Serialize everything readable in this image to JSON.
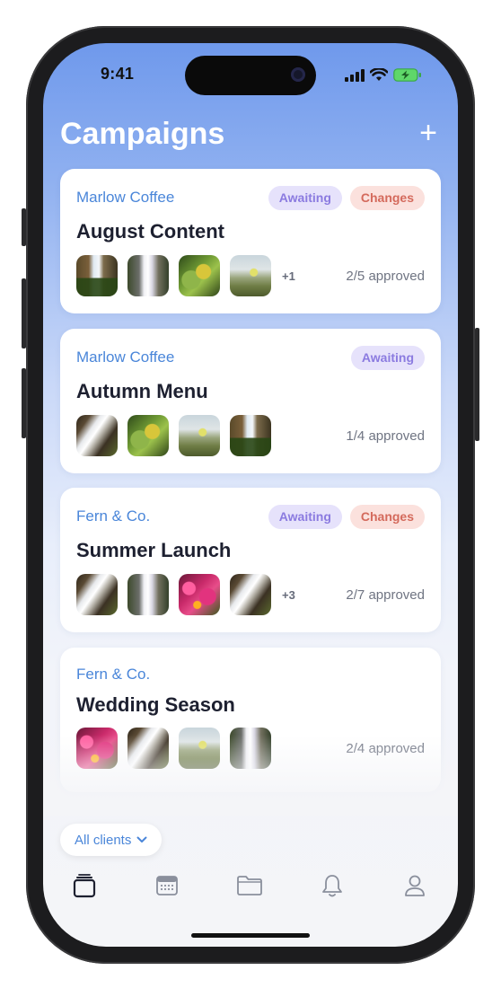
{
  "status_bar": {
    "time": "9:41",
    "icons": [
      "signal-icon",
      "wifi-icon",
      "battery-charging-icon"
    ]
  },
  "header": {
    "title": "Campaigns",
    "add_icon": "plus-icon"
  },
  "campaigns": [
    {
      "client": "Marlow Coffee",
      "title": "August Content",
      "badges": [
        "Awaiting",
        "Changes"
      ],
      "more": "+1",
      "approved": "2/5 approved",
      "thumbs": [
        "waterfall-cliff",
        "waterfall-misty",
        "green-leaves",
        "meadow-flower"
      ]
    },
    {
      "client": "Marlow Coffee",
      "title": "Autumn Menu",
      "badges": [
        "Awaiting"
      ],
      "more": "",
      "approved": "1/4 approved",
      "thumbs": [
        "waterfall-rocks",
        "green-leaves",
        "meadow-flower",
        "waterfall-cliff"
      ]
    },
    {
      "client": "Fern & Co.",
      "title": "Summer Launch",
      "badges": [
        "Awaiting",
        "Changes"
      ],
      "more": "+3",
      "approved": "2/7 approved",
      "thumbs": [
        "waterfall-rocks",
        "waterfall-misty",
        "pink-flowers",
        "waterfall-rocks"
      ]
    },
    {
      "client": "Fern & Co.",
      "title": "Wedding Season",
      "badges": [],
      "more": "",
      "approved": "2/4 approved",
      "thumbs": [
        "pink-flowers",
        "waterfall-rocks",
        "meadow-flower",
        "waterfall-misty"
      ]
    }
  ],
  "filter": {
    "label": "All clients",
    "icon": "chevron-down-icon"
  },
  "tabbar": [
    {
      "name": "campaigns",
      "icon": "stack-icon",
      "active": true
    },
    {
      "name": "calendar",
      "icon": "calendar-icon",
      "active": false
    },
    {
      "name": "files",
      "icon": "folder-icon",
      "active": false
    },
    {
      "name": "notifications",
      "icon": "bell-icon",
      "active": false
    },
    {
      "name": "profile",
      "icon": "person-icon",
      "active": false
    }
  ],
  "colors": {
    "accent": "#4a86d9",
    "awaiting_bg": "#e6e2fb",
    "awaiting_text": "#8b7be0",
    "changes_bg": "#fbe1dd",
    "changes_text": "#d46a5c"
  }
}
